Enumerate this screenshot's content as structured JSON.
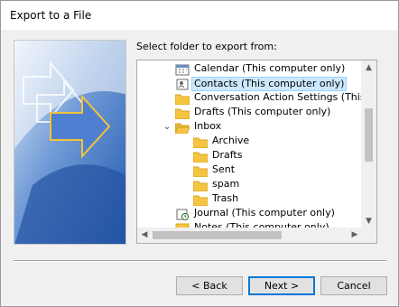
{
  "window": {
    "title": "Export to a File"
  },
  "prompt": "Select folder to export from:",
  "tree": [
    {
      "label": "Calendar (This computer only)",
      "icon": "calendar-icon",
      "indent": 1
    },
    {
      "label": "Contacts (This computer only)",
      "icon": "contacts-icon",
      "indent": 1,
      "selected": true
    },
    {
      "label": "Conversation Action Settings (This c",
      "icon": "folder-icon",
      "indent": 1
    },
    {
      "label": "Drafts (This computer only)",
      "icon": "folder-icon",
      "indent": 1
    },
    {
      "label": "Inbox",
      "icon": "folder-open-icon",
      "indent": 1,
      "expanded": true
    },
    {
      "label": "Archive",
      "icon": "folder-icon",
      "indent": 2
    },
    {
      "label": "Drafts",
      "icon": "folder-icon",
      "indent": 2
    },
    {
      "label": "Sent",
      "icon": "folder-icon",
      "indent": 2
    },
    {
      "label": "spam",
      "icon": "folder-icon",
      "indent": 2
    },
    {
      "label": "Trash",
      "icon": "folder-icon",
      "indent": 2
    },
    {
      "label": "Journal (This computer only)",
      "icon": "journal-icon",
      "indent": 1
    },
    {
      "label": "Notes (This computer only)",
      "icon": "notes-icon",
      "indent": 1
    }
  ],
  "buttons": {
    "back": "< Back",
    "next": "Next >",
    "cancel": "Cancel"
  },
  "colors": {
    "selection": "#cce8ff",
    "folder": "#f5c542",
    "accent": "#0078d7"
  }
}
